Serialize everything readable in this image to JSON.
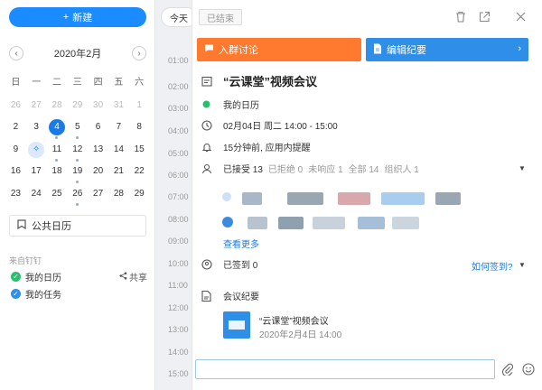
{
  "sidebar": {
    "new_label": "新建",
    "month_label": "2020年2月",
    "weekdays": [
      "日",
      "一",
      "二",
      "三",
      "四",
      "五",
      "六"
    ],
    "weeks": [
      [
        "26",
        "27",
        "28",
        "29",
        "30",
        "31",
        "1"
      ],
      [
        "2",
        "3",
        "4",
        "5",
        "6",
        "7",
        "8"
      ],
      [
        "9",
        "10",
        "11",
        "12",
        "13",
        "14",
        "15"
      ],
      [
        "16",
        "17",
        "18",
        "19",
        "20",
        "21",
        "22"
      ],
      [
        "23",
        "24",
        "25",
        "26",
        "27",
        "28",
        "29"
      ]
    ],
    "selected_day": "4",
    "public_calendar_label": "公共日历",
    "source_label": "来自钉钉",
    "calendars": [
      {
        "label": "我的日历",
        "color": "#2dbd6e"
      },
      {
        "label": "我的任务",
        "color": "#2f8ee8"
      }
    ],
    "share_label": "共享"
  },
  "timeline": {
    "today_label": "今天",
    "hours": [
      "01:00",
      "02:00",
      "03:00",
      "04:00",
      "05:00",
      "06:00",
      "07:00",
      "08:00",
      "09:00",
      "10:00",
      "11:00",
      "12:00",
      "13:00",
      "14:00",
      "15:00"
    ]
  },
  "event": {
    "ended_tag": "已结束",
    "group_chat_label": "入群讨论",
    "minutes_label": "编辑纪要",
    "title": "“云课堂”视频会议",
    "calendar": "我的日历",
    "calendar_color": "#2dbd6e",
    "datetime": "02月04日 周二 14:00 - 15:00",
    "reminder": "15分钟前, 应用内提醒",
    "attendance": {
      "accepted": "已接受 13",
      "declined": "已拒绝 0",
      "pending": "未响应 1",
      "total": "全部 14",
      "organizer": "组织人 1"
    },
    "see_more": "查看更多",
    "signed_in": "已签到 0",
    "how_signin": "如何签到?",
    "minutes_section": "会议纪要",
    "doc_name": "“云课堂”视频会议",
    "doc_date": "2020年2月4日 14:00"
  },
  "colors": {
    "primary": "#1a8cff",
    "orange": "#ff7a2f",
    "blue_button": "#2f8ee8"
  }
}
